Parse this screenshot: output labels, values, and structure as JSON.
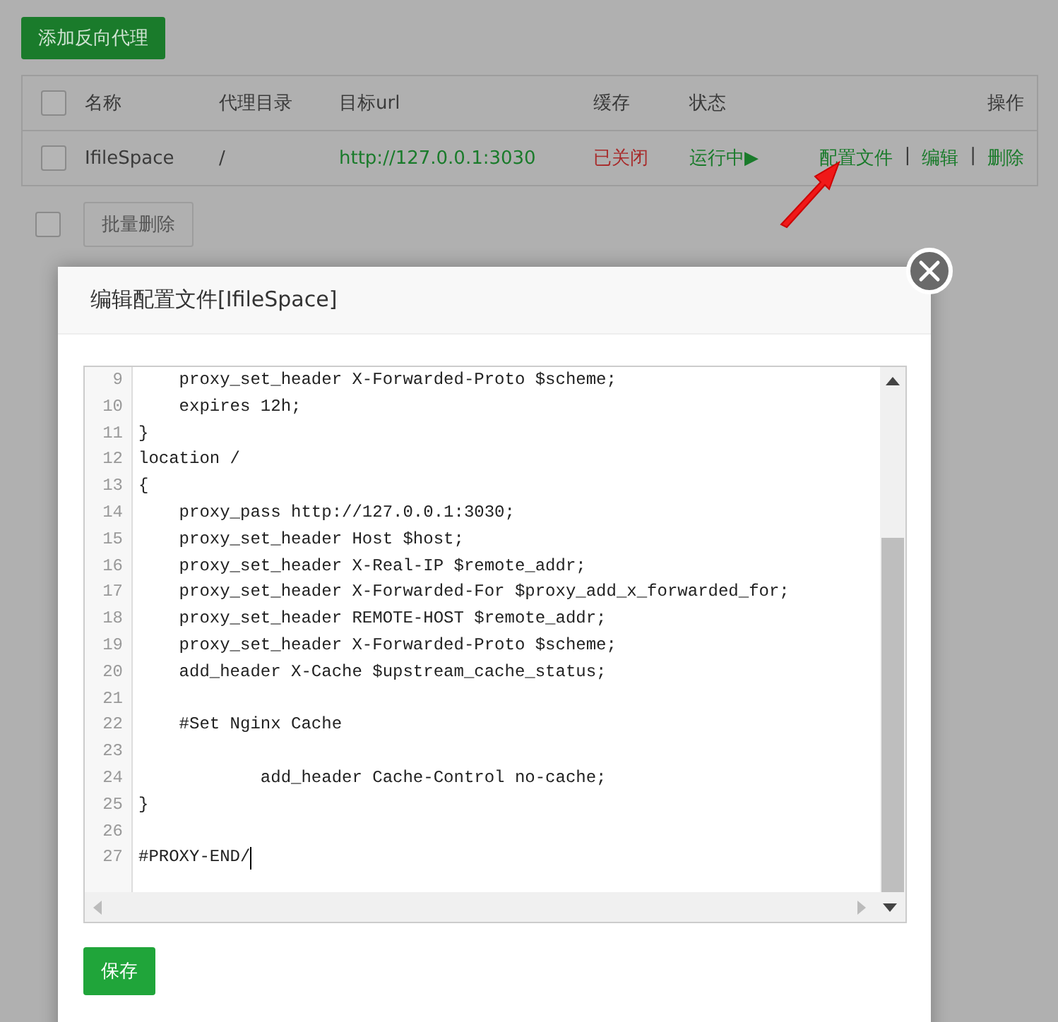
{
  "add_button": "添加反向代理",
  "table": {
    "columns": [
      "名称",
      "代理目录",
      "目标url",
      "缓存",
      "状态",
      "操作"
    ],
    "rows": [
      {
        "checked": false,
        "name": "IfileSpace",
        "dir": "/",
        "url": "http://127.0.0.1:3030",
        "cache": "已关闭",
        "status": "运行中▶",
        "actions": [
          "配置文件",
          "编辑",
          "删除"
        ],
        "separator": "|"
      }
    ]
  },
  "select_all_checked": false,
  "batch_checked": false,
  "batch_delete_button": "批量删除",
  "dialog": {
    "title": "编辑配置文件[IfileSpace]",
    "editor_lines": [
      {
        "number": "9",
        "text": "    proxy_set_header X-Forwarded-Proto $scheme;"
      },
      {
        "number": "10",
        "text": "    expires 12h;"
      },
      {
        "number": "11",
        "text": "}"
      },
      {
        "number": "12",
        "text": "location /"
      },
      {
        "number": "13",
        "text": "{"
      },
      {
        "number": "14",
        "text": "    proxy_pass http://127.0.0.1:3030;"
      },
      {
        "number": "15",
        "text": "    proxy_set_header Host $host;"
      },
      {
        "number": "16",
        "text": "    proxy_set_header X-Real-IP $remote_addr;"
      },
      {
        "number": "17",
        "text": "    proxy_set_header X-Forwarded-For $proxy_add_x_forwarded_for;"
      },
      {
        "number": "18",
        "text": "    proxy_set_header REMOTE-HOST $remote_addr;"
      },
      {
        "number": "19",
        "text": "    proxy_set_header X-Forwarded-Proto $scheme;"
      },
      {
        "number": "20",
        "text": "    add_header X-Cache $upstream_cache_status;"
      },
      {
        "number": "21"
      },
      {
        "number": "22",
        "text": "    #Set Nginx Cache"
      },
      {
        "number": "23"
      },
      {
        "number": "24",
        "text": "            add_header Cache-Control no-cache;"
      },
      {
        "number": "25",
        "text": "}"
      },
      {
        "number": "26"
      },
      {
        "number": "27",
        "text": "#PROXY-END/"
      }
    ],
    "save_button": "保存"
  }
}
